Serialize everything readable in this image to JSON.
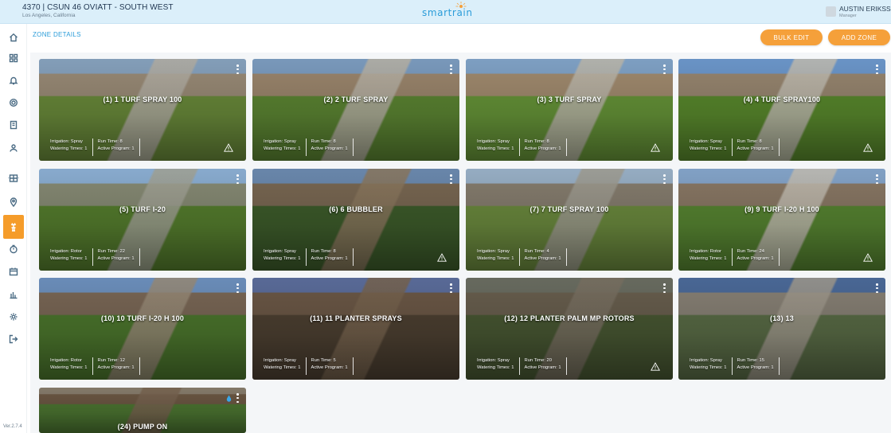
{
  "header": {
    "site_title": "4370 | CSUN 46 OVIATT - SOUTH WEST",
    "site_location": "Los Angeles, California",
    "logo_text": "smartrain",
    "user_name": "AUSTIN ERIKSSO",
    "user_role": "Manager"
  },
  "sidebar": {
    "items": [
      {
        "icon": "home-icon"
      },
      {
        "icon": "dashboard-grid-icon"
      },
      {
        "icon": "bell-icon"
      },
      {
        "icon": "settings-gear-icon"
      },
      {
        "icon": "controller-icon"
      },
      {
        "icon": "users-icon"
      },
      {
        "icon": "map-grid-icon"
      },
      {
        "icon": "location-pin-icon"
      },
      {
        "icon": "sprinkler-zone-icon",
        "active": true
      },
      {
        "icon": "timer-icon"
      },
      {
        "icon": "calendar-icon"
      },
      {
        "icon": "bar-chart-icon"
      },
      {
        "icon": "cog-icon"
      },
      {
        "icon": "logout-icon"
      }
    ],
    "version": "Ver.2.7.4"
  },
  "page": {
    "title": "ZONE DETAILS",
    "bulk_edit_label": "BULK EDIT",
    "add_zone_label": "ADD ZONE"
  },
  "labels": {
    "irrigation": "Irrigation:",
    "run_time": "Run Time:",
    "watering_times": "Watering Times:",
    "active_program": "Active Program:"
  },
  "colors": {
    "accent": "#2a9cd9",
    "button": "#f5a03a",
    "active_sidebar": "#f59c2a"
  },
  "zones": [
    {
      "title": "(1) 1 TURF SPRAY 100",
      "irrigation": "Irrigation: Spray",
      "run_time": "Run Time: 8",
      "watering": "Watering Times: 1",
      "program": "Active Program: 1",
      "warning": true
    },
    {
      "title": "(2) 2 TURF SPRAY",
      "irrigation": "Irrigation: Spray",
      "run_time": "Run Time: 8",
      "watering": "Watering Times: 1",
      "program": "Active Program: 1",
      "warning": false
    },
    {
      "title": "(3) 3 TURF SPRAY",
      "irrigation": "Irrigation: Spray",
      "run_time": "Run Time: 8",
      "watering": "Watering Times: 1",
      "program": "Active Program: 1",
      "warning": true
    },
    {
      "title": "(4) 4 TURF SPRAY100",
      "irrigation": "Irrigation: Spray",
      "run_time": "Run Time: 8",
      "watering": "Watering Times: 1",
      "program": "Active Program: 1",
      "warning": true
    },
    {
      "title": "(5) TURF I-20",
      "irrigation": "Irrigation: Rotor",
      "run_time": "Run Time: 22",
      "watering": "Watering Times: 1",
      "program": "Active Program: 1",
      "warning": false
    },
    {
      "title": "(6) 6 BUBBLER",
      "irrigation": "Irrigation: Spray",
      "run_time": "Run Time: 8",
      "watering": "Watering Times: 1",
      "program": "Active Program: 1",
      "warning": true
    },
    {
      "title": "(7) 7 TURF SPRAY 100",
      "irrigation": "Irrigation: Spray",
      "run_time": "Run Time: 4",
      "watering": "Watering Times: 1",
      "program": "Active Program: 1",
      "warning": false
    },
    {
      "title": "(9) 9 TURF I-20 H 100",
      "irrigation": "Irrigation: Rotor",
      "run_time": "Run Time: 24",
      "watering": "Watering Times: 1",
      "program": "Active Program: 1",
      "warning": true
    },
    {
      "title": "(10) 10 TURF I-20 H 100",
      "irrigation": "Irrigation: Rotor",
      "run_time": "Run Time: 12",
      "watering": "Watering Times: 1",
      "program": "Active Program: 1",
      "warning": false
    },
    {
      "title": "(11) 11 PLANTER SPRAYS",
      "irrigation": "Irrigation: Spray",
      "run_time": "Run Time: 5",
      "watering": "Watering Times: 1",
      "program": "Active Program: 1",
      "warning": false
    },
    {
      "title": "(12) 12 PLANTER PALM MP ROTORS",
      "irrigation": "Irrigation: Spray",
      "run_time": "Run Time: 20",
      "watering": "Watering Times: 1",
      "program": "Active Program: 1",
      "warning": true
    },
    {
      "title": "(13) 13",
      "irrigation": "Irrigation: Spray",
      "run_time": "Run Time: 15",
      "watering": "Watering Times: 1",
      "program": "Active Program: 1",
      "warning": false
    },
    {
      "title": "(24) PUMP ON",
      "irrigation": "",
      "run_time": "",
      "watering": "",
      "program": "",
      "warning": false,
      "drop": true
    }
  ]
}
